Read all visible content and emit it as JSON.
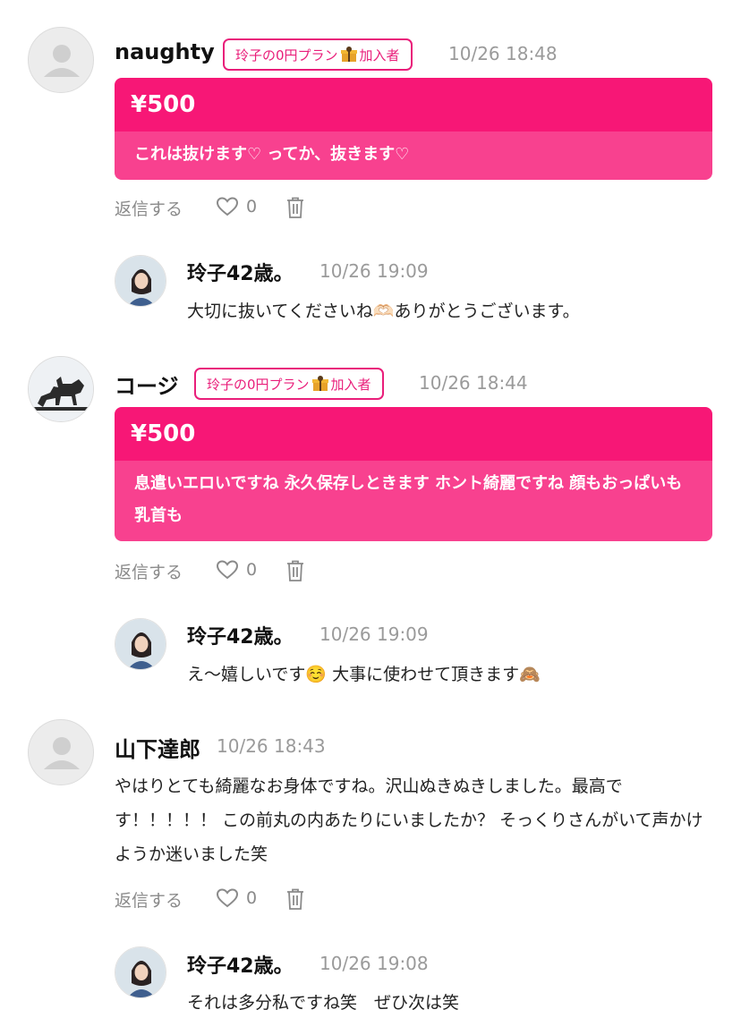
{
  "comments": [
    {
      "author": "naughty",
      "badge": "玲子の0円プラン",
      "badge_suffix": "加入者",
      "time": "10/26 18:48",
      "tip_amount": "¥500",
      "message": "これは抜けます♡ ってか、抜きます♡",
      "reply_label": "返信する",
      "like_count": "0",
      "reply": {
        "author": "玲子42歳。",
        "time": "10/26 19:09",
        "text": "大切に抜いてくださいね🫶🏻ありがとうございます。"
      }
    },
    {
      "author": "コージ",
      "badge": "玲子の0円プラン",
      "badge_suffix": "加入者",
      "time": "10/26 18:44",
      "tip_amount": "¥500",
      "message": "息遣いエロいですね 永久保存しときます ホント綺麗ですね 顔もおっぱいも乳首も",
      "reply_label": "返信する",
      "like_count": "0",
      "reply": {
        "author": "玲子42歳。",
        "time": "10/26 19:09",
        "text": "え〜嬉しいです☺️ 大事に使わせて頂きます🙈"
      }
    },
    {
      "author": "山下達郎",
      "time": "10/26 18:43",
      "text": "やはりとても綺麗なお身体ですね。沢山ぬきぬきしました。最高です！！！！！ この前丸の内あたりにいましたか？ そっくりさんがいて声かけようか迷いました笑",
      "reply_label": "返信する",
      "like_count": "0",
      "reply": {
        "author": "玲子42歳。",
        "time": "10/26 19:08",
        "text": "それは多分私ですね笑　ぜひ次は笑"
      }
    }
  ],
  "colors": {
    "accent": "#f71776",
    "accent_light": "#f8418f",
    "muted": "#9a9a9a"
  },
  "icons": [
    "person-placeholder-icon",
    "heart-icon",
    "trash-icon",
    "gift-icon"
  ]
}
